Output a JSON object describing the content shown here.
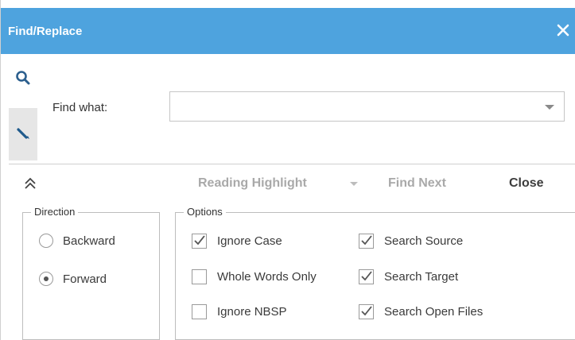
{
  "window": {
    "title": "Find/Replace",
    "accent_color": "#4ea3de",
    "close_icon": "close-icon"
  },
  "sidebar": {
    "tabs": [
      {
        "icon": "search-icon",
        "active": false
      },
      {
        "icon": "pencil-icon",
        "active": true
      }
    ]
  },
  "find": {
    "label": "Find what:",
    "value": "",
    "placeholder": ""
  },
  "toolbar": {
    "collapse_icon": "double-chevron-up-icon",
    "reading_highlight": "Reading Highlight",
    "find_next": "Find Next",
    "close": "Close"
  },
  "direction": {
    "legend": "Direction",
    "options": [
      {
        "label": "Backward",
        "selected": false
      },
      {
        "label": "Forward",
        "selected": true
      }
    ]
  },
  "options": {
    "legend": "Options",
    "items": [
      {
        "label": "Ignore Case",
        "checked": true
      },
      {
        "label": "Whole Words Only",
        "checked": false
      },
      {
        "label": "Ignore NBSP",
        "checked": false
      },
      {
        "label": "Search Source",
        "checked": true
      },
      {
        "label": "Search Target",
        "checked": true
      },
      {
        "label": "Search Open Files",
        "checked": true
      }
    ]
  }
}
